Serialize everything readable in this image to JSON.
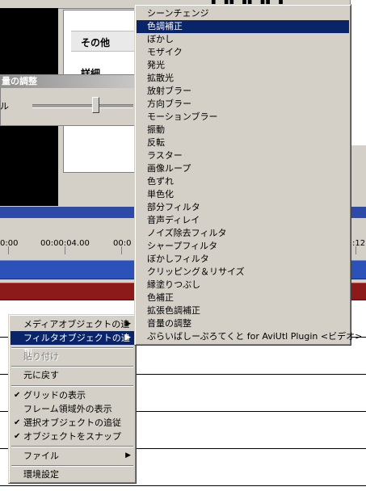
{
  "background": {
    "property_group": "その他",
    "property_detail": "詳細",
    "volume_dialog_title": "量の調整",
    "volume_label": "ル",
    "timeline_ticks": [
      "0:00",
      "00:00:04.00",
      "00:0",
      ":12."
    ]
  },
  "context_menu": {
    "items": [
      {
        "label": "メディアオブジェクトの追加",
        "submenu": true
      },
      {
        "label": "フィルタオブジェクトの追加",
        "submenu": true,
        "selected": true
      },
      {
        "label": "貼り付け",
        "disabled": true
      },
      {
        "label": "元に戻す"
      },
      {
        "label": "グリッドの表示",
        "checked": true
      },
      {
        "label": "フレーム領域外の表示"
      },
      {
        "label": "選択オブジェクトの追従",
        "checked": true
      },
      {
        "label": "オブジェクトをスナップ",
        "checked": true
      },
      {
        "label": "ファイル",
        "submenu": true
      },
      {
        "label": "環境設定"
      }
    ],
    "check_glyph": "✔",
    "arrow_glyph": "▶"
  },
  "filter_submenu": {
    "items": [
      "シーンチェンジ",
      "色調補正",
      "ぼかし",
      "モザイク",
      "発光",
      "拡散光",
      "放射ブラー",
      "方向ブラー",
      "モーションブラー",
      "振動",
      "反転",
      "ラスター",
      "画像ループ",
      "色ずれ",
      "単色化",
      "部分フィルタ",
      "音声ディレイ",
      "ノイズ除去フィルタ",
      "シャープフィルタ",
      "ぼかしフィルタ",
      "クリッピング＆リサイズ",
      "縁塗りつぶし",
      "色補正",
      "拡張色調補正",
      "音量の調整",
      "ぷらいばしーぷろてくと for AviUtl Plugin <ビデオ>"
    ],
    "selected_index": 1
  },
  "colors": {
    "menu_bg": "#d4d0c8",
    "selection": "#0a246a",
    "timeline_blue": "#2a52b8",
    "timeline_red": "#8c1a1a"
  }
}
